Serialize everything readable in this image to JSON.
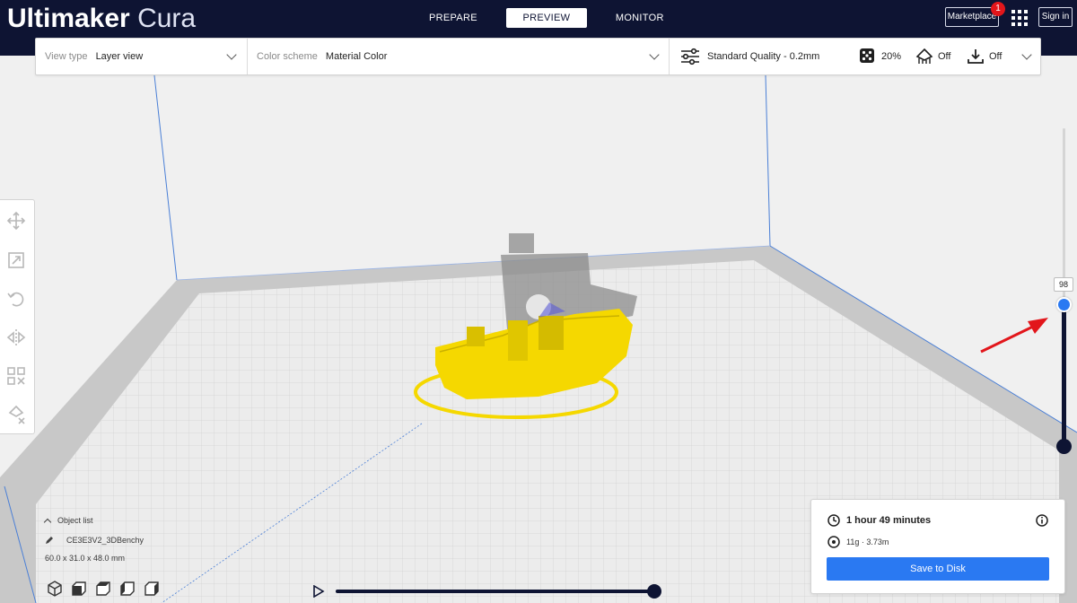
{
  "header": {
    "logo_brand": "Ultimaker",
    "logo_product": "Cura",
    "tabs": [
      {
        "label": "PREPARE",
        "active": false
      },
      {
        "label": "PREVIEW",
        "active": true
      },
      {
        "label": "MONITOR",
        "active": false
      }
    ],
    "marketplace_label": "Marketplace",
    "marketplace_badge": "1",
    "signin_label": "Sign in"
  },
  "toolbar": {
    "view_type_label": "View type",
    "view_type_value": "Layer view",
    "color_scheme_label": "Color scheme",
    "color_scheme_value": "Material Color",
    "profile": "Standard Quality - 0.2mm",
    "infill": "20%",
    "support": "Off",
    "adhesion": "Off"
  },
  "left_tools": [
    {
      "name": "move-tool-icon"
    },
    {
      "name": "scale-tool-icon"
    },
    {
      "name": "rotate-tool-icon"
    },
    {
      "name": "mirror-tool-icon"
    },
    {
      "name": "per-model-settings-icon"
    },
    {
      "name": "support-blocker-icon"
    }
  ],
  "object_list": {
    "title": "Object list",
    "object_name": "CE3E3V2_3DBenchy",
    "dimensions": "60.0 x 31.0 x 48.0 mm"
  },
  "layer_slider": {
    "current_layer": "98"
  },
  "print_info": {
    "time": "1 hour 49 minutes",
    "material": "11g · 3.73m",
    "save_label": "Save to Disk"
  },
  "colors": {
    "header_bg": "#0e1433",
    "accent_blue": "#2a79f2",
    "model_yellow": "#f5d800",
    "arrow_red": "#e2161b"
  }
}
